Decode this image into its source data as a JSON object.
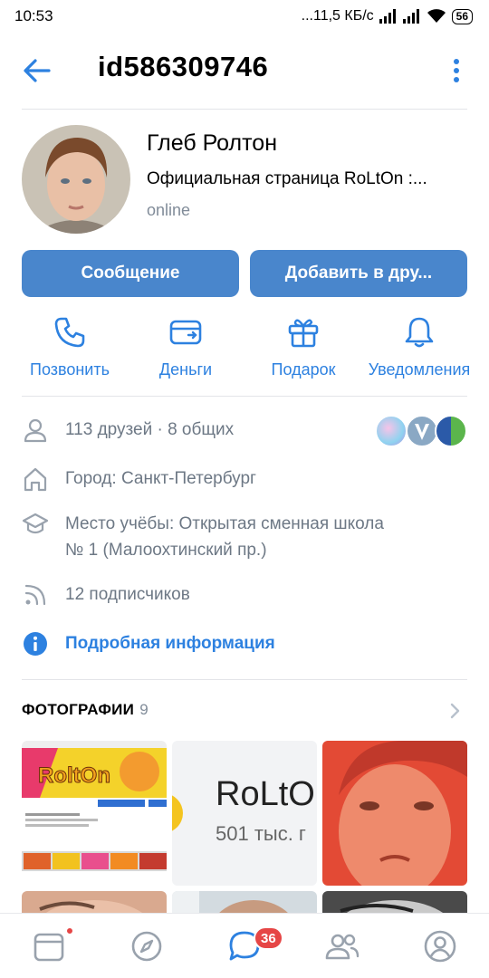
{
  "status_bar": {
    "time": "10:53",
    "network_speed": "...11,5 КБ/с",
    "battery": "56"
  },
  "header": {
    "title": "id586309746"
  },
  "profile": {
    "name": "Глеб Ролтон",
    "status": "Официальная страница RoLtOn :...",
    "online": "online"
  },
  "buttons": {
    "message": "Сообщение",
    "add_friend": "Добавить в дру..."
  },
  "actions": [
    {
      "label": "Позвонить",
      "icon": "phone-icon"
    },
    {
      "label": "Деньги",
      "icon": "money-card-icon"
    },
    {
      "label": "Подарок",
      "icon": "gift-icon"
    },
    {
      "label": "Уведомления",
      "icon": "bell-icon"
    }
  ],
  "info": {
    "friends": "113 друзей · 8 общих",
    "city": "Город: Санкт-Петербург",
    "education_line1": "Место учёбы: Открытая сменная школа",
    "education_line2": "№ 1 (Малоохтинский пр.)",
    "subscribers": "12 подписчиков",
    "details_link": "Подробная информация"
  },
  "photos": {
    "title": "ФОТОГРАФИИ",
    "count": "9",
    "photo2_text1": "RoLtO",
    "photo2_text2": "501 тыс. г"
  },
  "bottom_nav": {
    "messages_badge": "36"
  },
  "colors": {
    "accent": "#2d81e0",
    "button": "#4986cc",
    "secondary_text": "#6d7885",
    "badge": "#e64646"
  }
}
